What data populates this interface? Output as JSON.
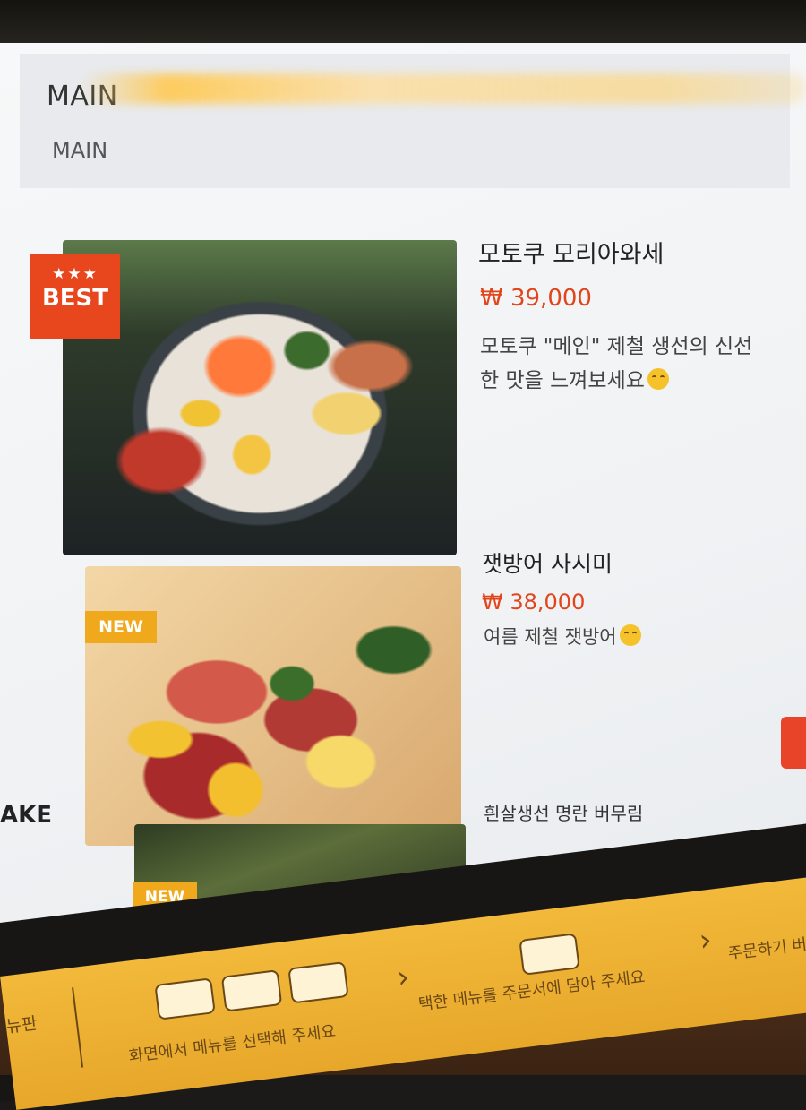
{
  "category": {
    "title": "MAIN",
    "subtitle": "MAIN"
  },
  "items": [
    {
      "badge_stars": "★★★",
      "badge": "BEST",
      "name": "모토쿠 모리아와세",
      "price": "₩ 39,000",
      "description_line1": "모토쿠 \"메인\" 제철 생선의 신선",
      "description_line2": "한 맛을 느껴보세요",
      "emoji": "smile-emoji"
    },
    {
      "badge": "NEW",
      "name": "잿방어 사시미",
      "price": "₩ 38,000",
      "description_line1": "여름 제철 잿방어",
      "emoji": "smile-emoji"
    },
    {
      "badge": "NEW",
      "name": "흰살생선 명란 버무림"
    }
  ],
  "side_category": "AKE",
  "bottom_bar": {
    "left_label": "뉴판",
    "step1": "화면에서 메뉴를 선택해 주세요",
    "step2": "택한 메뉴를 주문서에 담아 주세요",
    "step3": "주문하기 버",
    "colors": {
      "bar": "#f2b93a",
      "accent": "#e2441c",
      "new_badge": "#f0a91c",
      "best_badge": "#e8471d"
    }
  }
}
